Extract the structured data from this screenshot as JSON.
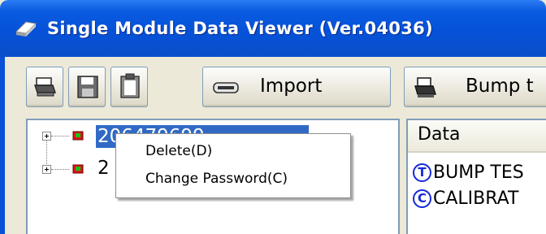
{
  "window": {
    "title": "Single Module Data Viewer (Ver.04036)"
  },
  "toolbar": {
    "print_icon": "printer-icon",
    "save_icon": "floppy-disk-icon",
    "clipboard_icon": "clipboard-icon",
    "import_icon": "drive-icon",
    "import_label": "Import",
    "bump_label": "Bump t"
  },
  "tree": {
    "items": [
      {
        "label": "206479699",
        "selected": true
      },
      {
        "label": "2"
      }
    ]
  },
  "data_panel": {
    "header": "Data",
    "rows": [
      {
        "badge": "T",
        "text": "BUMP TES"
      },
      {
        "badge": "C",
        "text": "CALIBRAT"
      }
    ]
  },
  "context_menu": {
    "items": [
      {
        "label": "Delete(D)"
      },
      {
        "label": "Change Password(C)"
      }
    ]
  },
  "colors": {
    "titlebar": "#0552d9",
    "selection": "#316ac5",
    "badge": "#1428d8"
  }
}
